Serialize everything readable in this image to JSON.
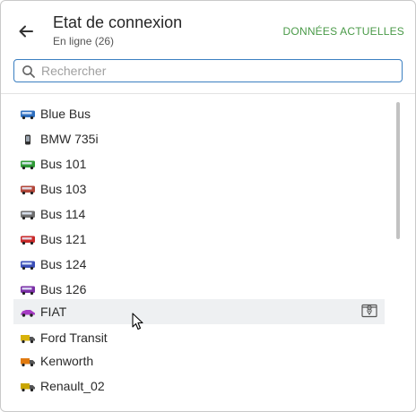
{
  "header": {
    "title": "Etat de connexion",
    "subtitle": "En ligne (26)",
    "current_data_label": "DONNÉES ACTUELLES",
    "back_icon": "arrow-left-icon",
    "accent_color": "#4a9a48"
  },
  "search": {
    "placeholder": "Rechercher",
    "value": "",
    "icon": "search-icon",
    "border_color": "#3b7fc1"
  },
  "units": [
    {
      "label": "Blue Bus",
      "icon": "bus-icon",
      "color": "#2f6fbf"
    },
    {
      "label": "BMW 735i",
      "icon": "phone-icon",
      "color": "#2f2f2f"
    },
    {
      "label": "Bus 101",
      "icon": "bus-icon",
      "color": "#2f9a36"
    },
    {
      "label": "Bus 103",
      "icon": "bus-icon",
      "color": "#b2473a"
    },
    {
      "label": "Bus 114",
      "icon": "bus-icon",
      "color": "#6e6e6e"
    },
    {
      "label": "Bus 121",
      "icon": "bus-icon",
      "color": "#c92a2a"
    },
    {
      "label": "Bus 124",
      "icon": "bus-icon",
      "color": "#3b4fb8"
    },
    {
      "label": "Bus 126",
      "icon": "bus-icon",
      "color": "#7b2fa6"
    },
    {
      "label": "FIAT",
      "icon": "car-icon",
      "color": "#a63cc4",
      "selected": true
    },
    {
      "label": "Ford Transit",
      "icon": "truck-icon",
      "color": "#d8b20a"
    },
    {
      "label": "Kenworth",
      "icon": "truck-icon",
      "color": "#e07a10"
    },
    {
      "label": "Renault_02",
      "icon": "truck-icon",
      "color": "#c9a600"
    }
  ],
  "row_action": {
    "icon": "map-pin-window-icon"
  }
}
